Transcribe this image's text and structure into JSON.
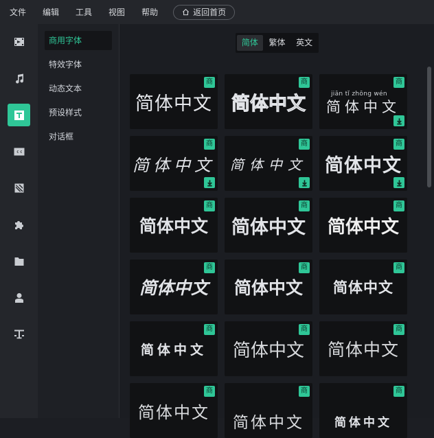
{
  "menubar": {
    "items": [
      "文件",
      "编辑",
      "工具",
      "视图",
      "帮助"
    ],
    "home_button": "返回首页"
  },
  "iconbar": {
    "items": [
      {
        "icon": "film-icon"
      },
      {
        "icon": "music-icon"
      },
      {
        "icon": "text-icon",
        "active": true
      },
      {
        "icon": "caption-icon"
      },
      {
        "icon": "filter-icon"
      },
      {
        "icon": "puzzle-icon"
      },
      {
        "icon": "folder-icon"
      },
      {
        "icon": "person-icon"
      },
      {
        "icon": "text-style-icon"
      }
    ]
  },
  "categories": {
    "items": [
      "商用字体",
      "特效字体",
      "动态文本",
      "预设样式",
      "对话框"
    ],
    "active_index": 0
  },
  "segment": {
    "items": [
      "简体",
      "繁体",
      "英文"
    ],
    "active_index": 0
  },
  "font_cards": {
    "sample_text": "简体中文",
    "badge_label": "商",
    "pinyin": "jiān  tǐ  zhōng  wén",
    "cards": [
      {
        "style": "thin",
        "download": false
      },
      {
        "style": "outline",
        "download": false
      },
      {
        "style": "pinyin",
        "download": true
      },
      {
        "style": "brush",
        "download": true
      },
      {
        "style": "script",
        "download": true
      },
      {
        "style": "bold",
        "download": true
      },
      {
        "style": "heavy",
        "download": false
      },
      {
        "style": "heavy2",
        "download": false
      },
      {
        "style": "heavy3",
        "download": false
      },
      {
        "style": "italic-bold",
        "download": false
      },
      {
        "style": "heavy",
        "download": false
      },
      {
        "style": "stencil",
        "download": false
      },
      {
        "style": "wide",
        "download": false
      },
      {
        "style": "light",
        "download": false
      },
      {
        "style": "light2",
        "download": false
      },
      {
        "style": "light3",
        "download": false
      },
      {
        "style": "round",
        "download": false
      },
      {
        "style": "deco",
        "download": false
      }
    ]
  },
  "colors": {
    "accent": "#2fc697",
    "panel": "#24262b",
    "card": "#111214"
  }
}
